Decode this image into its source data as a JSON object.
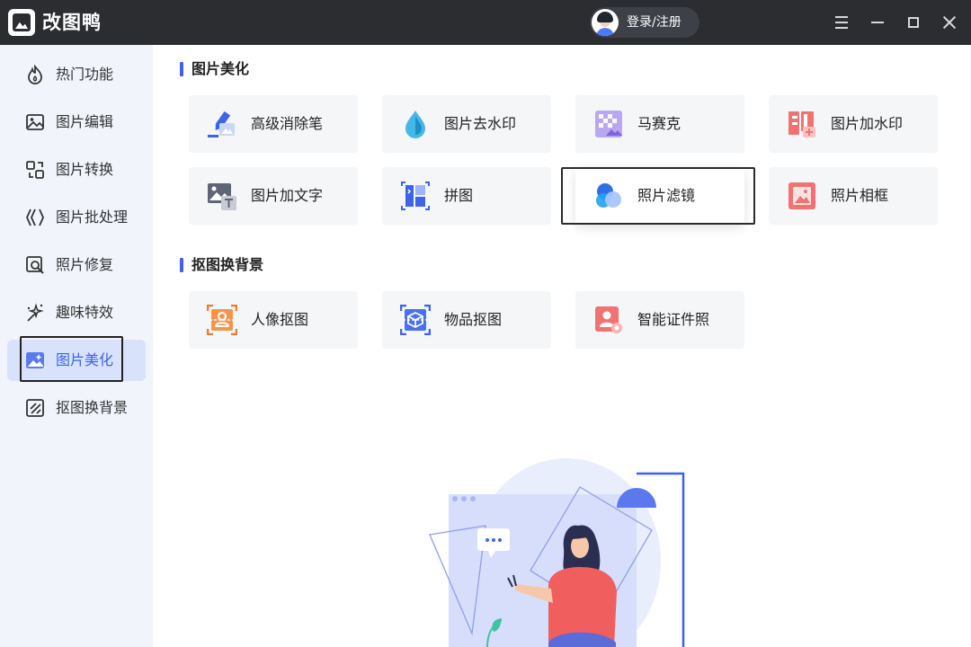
{
  "app": {
    "title": "改图鸭"
  },
  "header": {
    "login_label": "登录/注册"
  },
  "sidebar": {
    "items": [
      {
        "label": "热门功能",
        "icon": "fire-icon"
      },
      {
        "label": "图片编辑",
        "icon": "image-edit-icon"
      },
      {
        "label": "图片转换",
        "icon": "image-convert-icon"
      },
      {
        "label": "图片批处理",
        "icon": "batch-icon"
      },
      {
        "label": "照片修复",
        "icon": "photo-repair-icon"
      },
      {
        "label": "趣味特效",
        "icon": "sparkle-icon"
      },
      {
        "label": "图片美化",
        "icon": "image-beautify-icon",
        "active": true
      },
      {
        "label": "抠图换背景",
        "icon": "cutout-icon"
      }
    ]
  },
  "main": {
    "beautify": {
      "title": "图片美化",
      "tiles": [
        {
          "label": "高级消除笔",
          "icon": "eraser-pen-icon"
        },
        {
          "label": "图片去水印",
          "icon": "water-drop-icon"
        },
        {
          "label": "马赛克",
          "icon": "mosaic-icon"
        },
        {
          "label": "图片加水印",
          "icon": "add-watermark-icon"
        },
        {
          "label": "图片加文字",
          "icon": "add-text-icon"
        },
        {
          "label": "拼图",
          "icon": "collage-icon"
        },
        {
          "label": "照片滤镜",
          "icon": "filter-icon"
        },
        {
          "label": "照片相框",
          "icon": "photo-frame-icon"
        }
      ]
    },
    "cutout": {
      "title": "抠图换背景",
      "tiles": [
        {
          "label": "人像抠图",
          "icon": "portrait-cutout-icon"
        },
        {
          "label": "物品抠图",
          "icon": "object-cutout-icon"
        },
        {
          "label": "智能证件照",
          "icon": "id-photo-icon"
        }
      ]
    }
  },
  "colors": {
    "accent": "#3f63e8",
    "titlebar": "#2b2d31",
    "sidebar_bg": "#f1f4fb"
  }
}
